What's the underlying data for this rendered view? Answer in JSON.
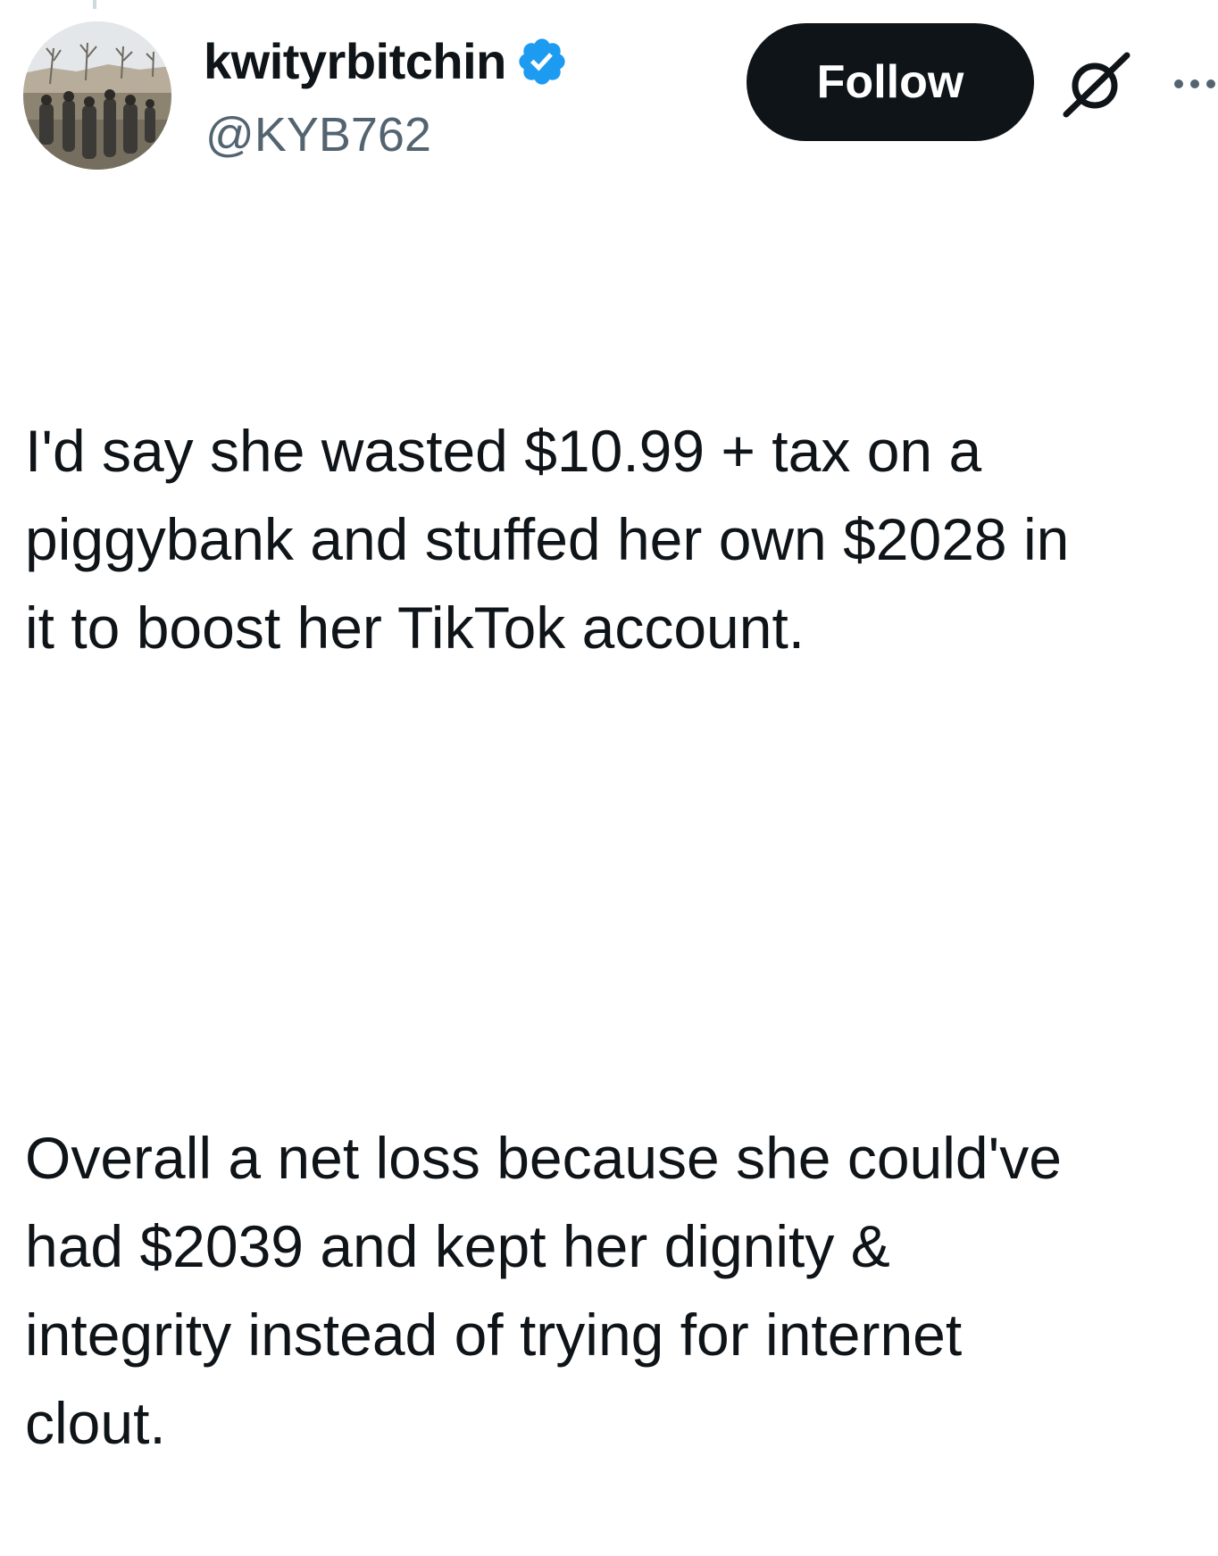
{
  "author": {
    "display_name": "kwityrbitchin",
    "handle": "@KYB762",
    "verified": true,
    "verified_color": "#1d9bf0"
  },
  "actions": {
    "follow_label": "Follow",
    "grok_icon": "grok-slash-icon",
    "more_icon": "more-ellipsis-icon"
  },
  "tweet": {
    "paragraphs": [
      "I'd say she wasted $10.99 + tax on a\npiggybank and stuffed her own $2028 in\nit to boost her TikTok account.",
      "Overall a net loss because she could've\nhad $2039 and kept her dignity &\nintegrity instead of trying for internet\nclout."
    ]
  },
  "colors": {
    "text": "#0f1419",
    "secondary": "#536471",
    "button_bg": "#0f1419",
    "button_text": "#ffffff"
  }
}
